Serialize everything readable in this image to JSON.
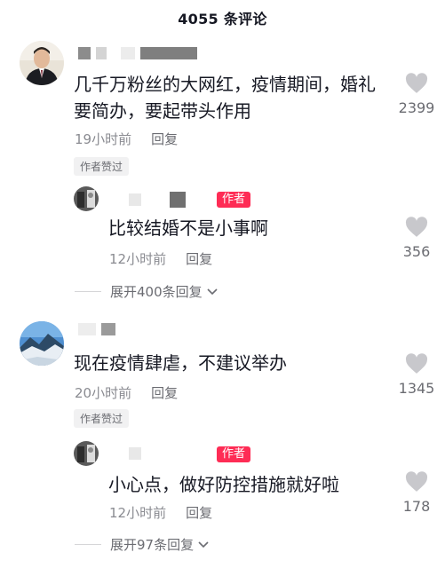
{
  "header": {
    "title": "4055 条评论"
  },
  "comments": [
    {
      "text_lines": [
        "几千万粉丝的大网红，疫情期间，婚礼",
        "要简办，要起带头作用"
      ],
      "time": "19小时前",
      "reply_label": "回复",
      "badge": "作者赞过",
      "likes": "2399"
    },
    {
      "text_lines": [
        "现在疫情肆虐，不建议举办"
      ],
      "time": "20小时前",
      "reply_label": "回复",
      "badge": "作者赞过",
      "likes": "1345"
    }
  ],
  "replies": [
    {
      "author_tag": "作者",
      "text": "比较结婚不是小事啊",
      "time": "12小时前",
      "reply_label": "回复",
      "likes": "356",
      "expand_label": "展开400条回复"
    },
    {
      "author_tag": "作者",
      "text": "小心点，做好防控措施就好啦",
      "time": "12小时前",
      "reply_label": "回复",
      "likes": "178",
      "expand_label": "展开97条回复"
    }
  ],
  "icons": {
    "like": "heart-icon",
    "expand": "chevron-down-icon"
  },
  "colors": {
    "author_tag_bg": "#fe2c55",
    "like_heart": "#c8c8cc",
    "meta_text": "#8a8b91"
  }
}
